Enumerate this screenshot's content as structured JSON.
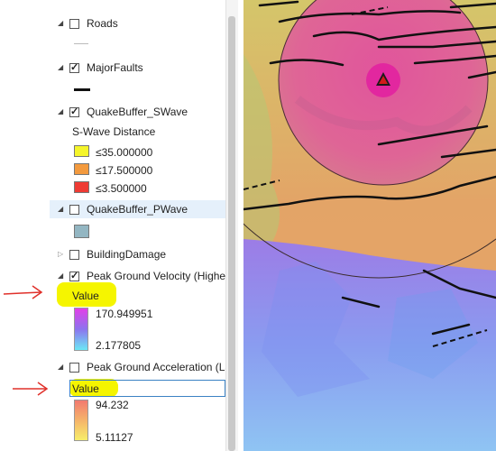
{
  "toc": {
    "layers": [
      {
        "name": "Roads",
        "checked": false
      },
      {
        "name": "MajorFaults",
        "checked": true
      },
      {
        "name": "QuakeBuffer_SWave",
        "checked": true
      },
      {
        "name": "QuakeBuffer_PWave",
        "checked": false
      },
      {
        "name": "BuildingDamage",
        "checked": false
      },
      {
        "name": "Peak Ground Velocity (Highe",
        "checked": true
      },
      {
        "name": "Peak Ground Acceleration (La",
        "checked": false
      }
    ],
    "swave": {
      "heading": "S-Wave Distance",
      "classes": [
        {
          "label": "≤35.000000",
          "color": "#f5f52a"
        },
        {
          "label": "≤17.500000",
          "color": "#f39a3e"
        },
        {
          "label": "≤3.500000",
          "color": "#ee3b34"
        }
      ]
    },
    "pwave_color": "#93b6c2",
    "pgv": {
      "field": "Value",
      "max": "170.949951",
      "min": "2.177805"
    },
    "pga": {
      "field": "Value",
      "max": "94.232",
      "min": "5.11127"
    }
  },
  "colors": {
    "highlight": "#f5f500",
    "annotation_arrow": "#e0302a",
    "selection": "#e5f0fb"
  }
}
